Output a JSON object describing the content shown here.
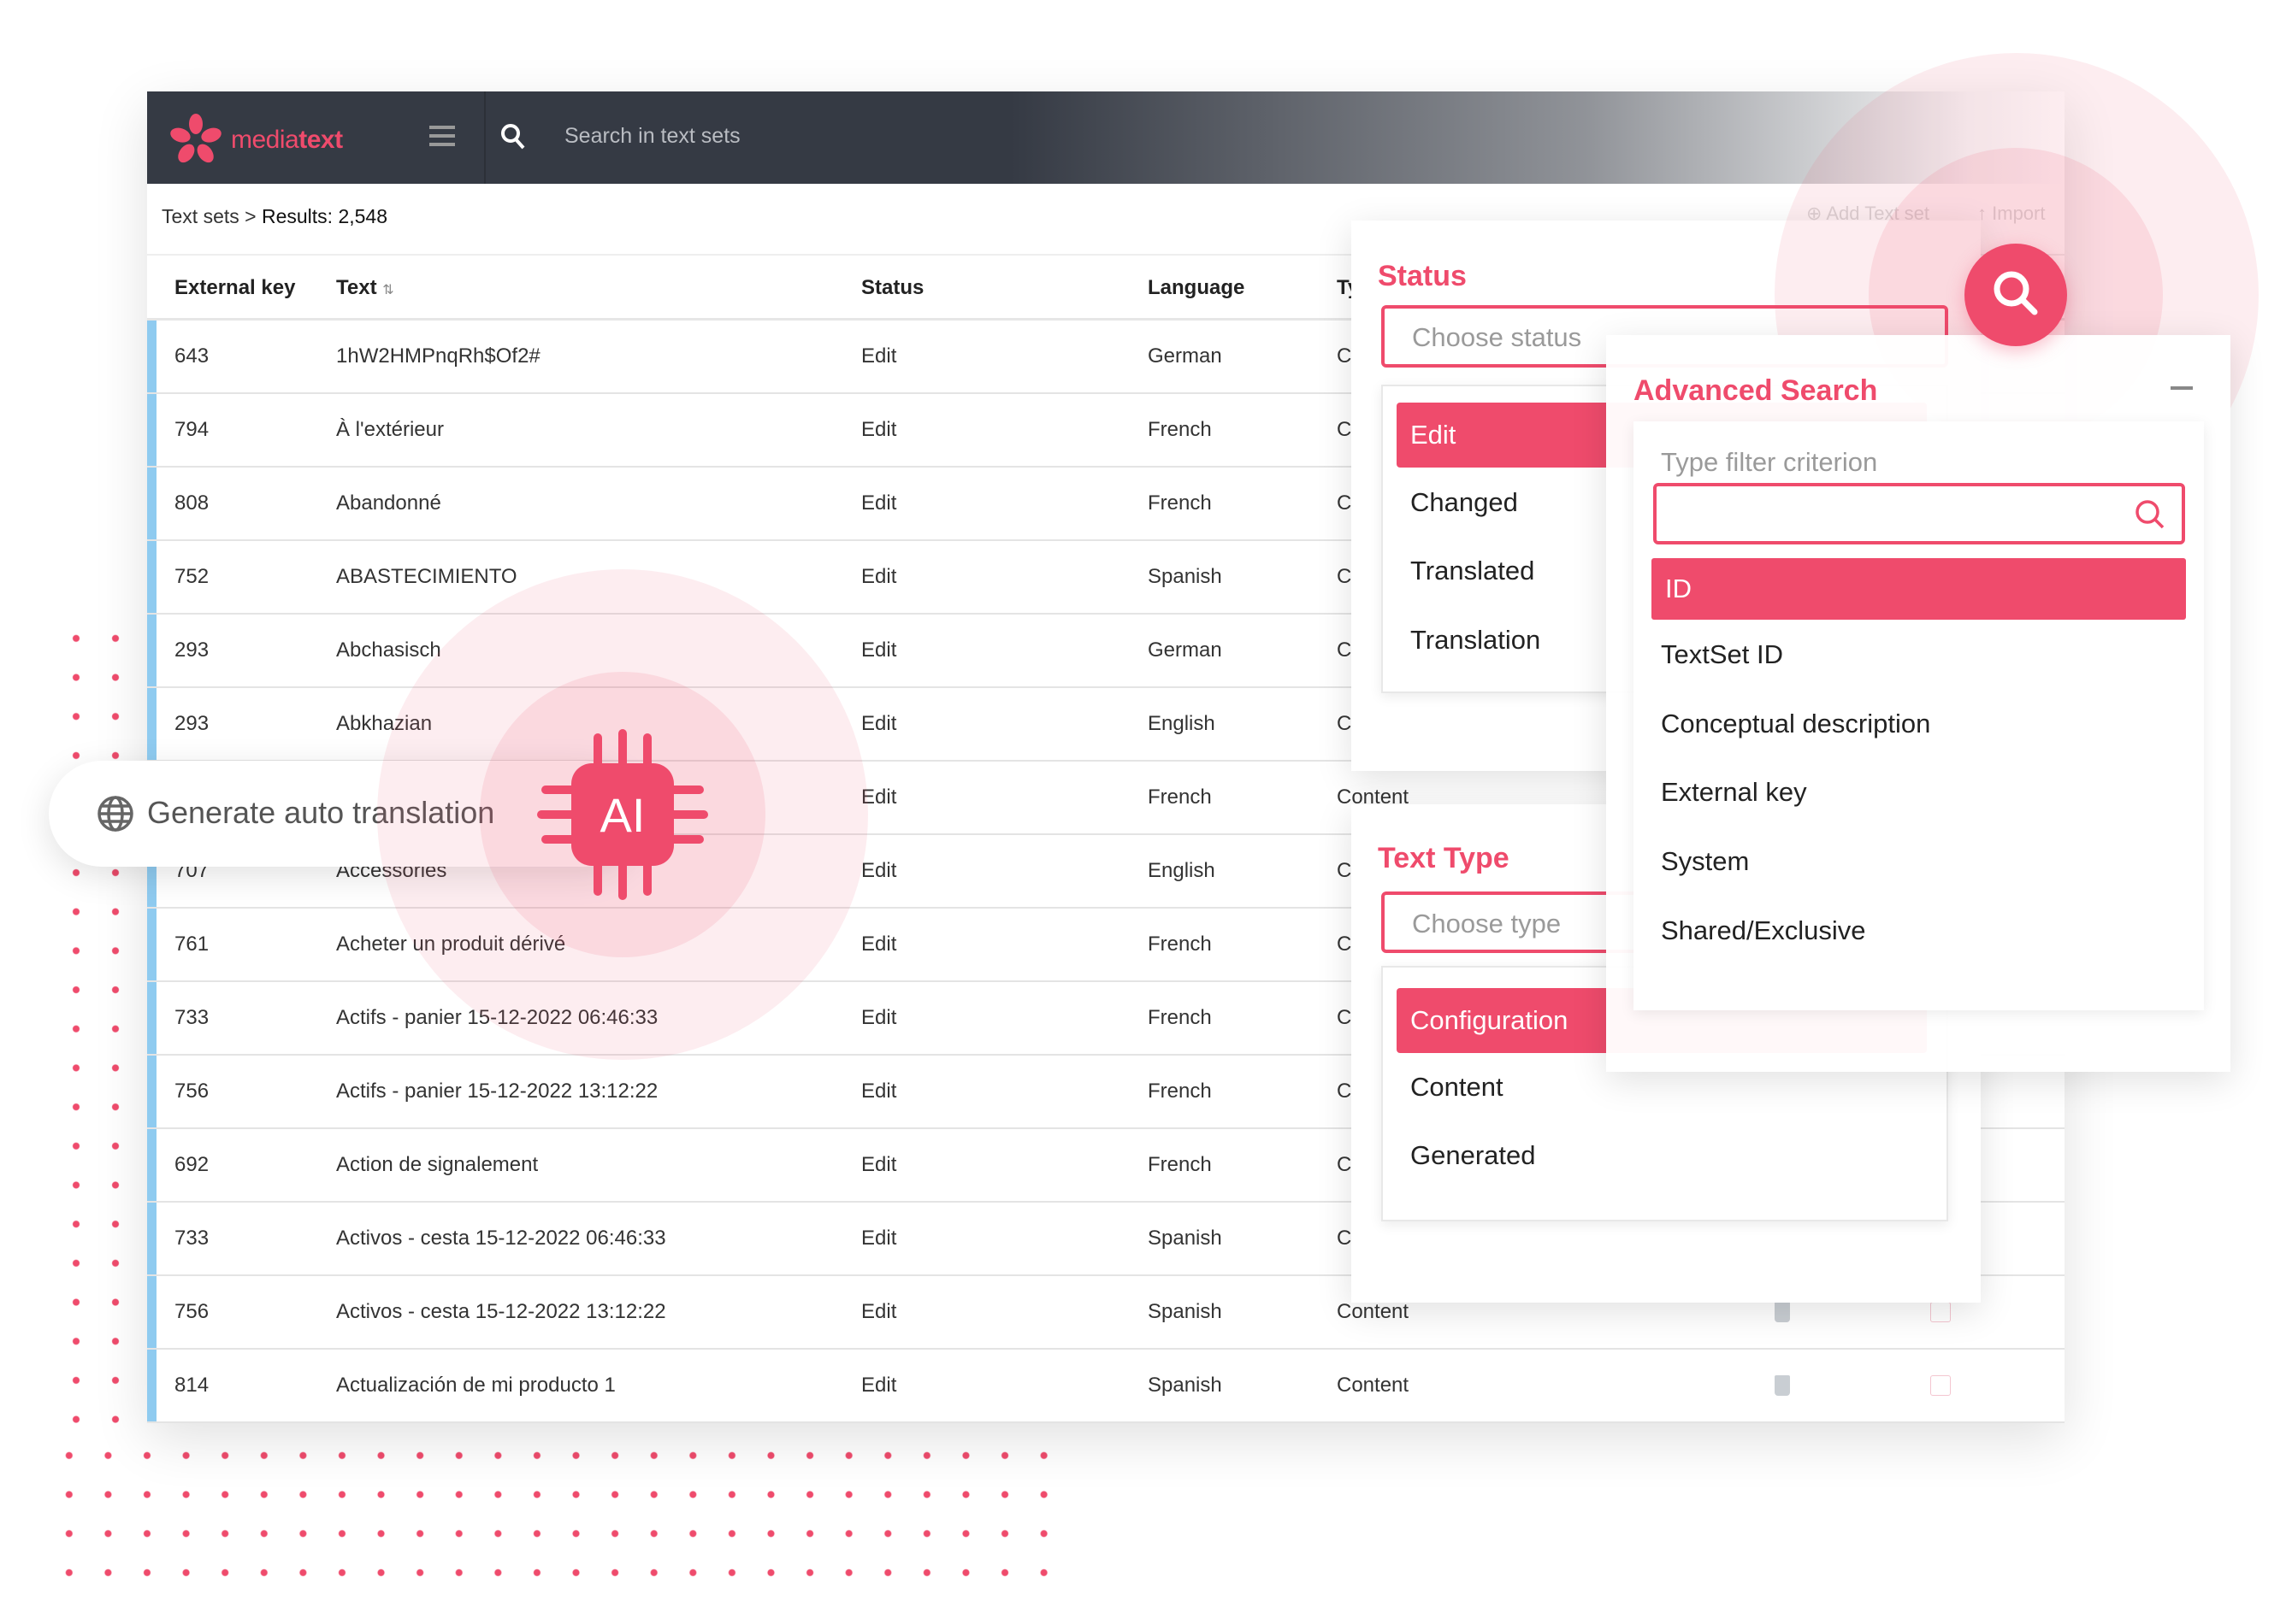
{
  "app": {
    "logo": {
      "part1": "media",
      "part2": "text"
    },
    "search_placeholder": "Search in text sets",
    "breadcrumb": {
      "root": "Text sets",
      "sep": ">",
      "results": "Results: 2,548"
    },
    "actions": {
      "add": "Add Text set",
      "import": "Import"
    }
  },
  "table": {
    "columns": {
      "external_key": "External key",
      "text": "Text",
      "status": "Status",
      "language": "Language",
      "type": "Type"
    },
    "rows": [
      {
        "key": "643",
        "text": "1hW2HMPnqRh$Of2#",
        "status": "Edit",
        "language": "German",
        "type": "Content"
      },
      {
        "key": "794",
        "text": "À l'extérieur",
        "status": "Edit",
        "language": "French",
        "type": "Content"
      },
      {
        "key": "808",
        "text": "Abandonné",
        "status": "Edit",
        "language": "French",
        "type": "Content"
      },
      {
        "key": "752",
        "text": "ABASTECIMIENTO",
        "status": "Edit",
        "language": "Spanish",
        "type": "Content"
      },
      {
        "key": "293",
        "text": "Abchasisch",
        "status": "Edit",
        "language": "German",
        "type": "Content"
      },
      {
        "key": "293",
        "text": "Abkhazian",
        "status": "Edit",
        "language": "English",
        "type": "Content"
      },
      {
        "key": "",
        "text": "",
        "status": "Edit",
        "language": "French",
        "type": "Content"
      },
      {
        "key": "707",
        "text": "Accessories",
        "status": "Edit",
        "language": "English",
        "type": "Content"
      },
      {
        "key": "761",
        "text": "Acheter un produit dérivé",
        "status": "Edit",
        "language": "French",
        "type": "Content"
      },
      {
        "key": "733",
        "text": "Actifs - panier 15-12-2022 06:46:33",
        "status": "Edit",
        "language": "French",
        "type": "Content"
      },
      {
        "key": "756",
        "text": "Actifs - panier 15-12-2022 13:12:22",
        "status": "Edit",
        "language": "French",
        "type": "Content"
      },
      {
        "key": "692",
        "text": "Action de signalement",
        "status": "Edit",
        "language": "French",
        "type": "Content"
      },
      {
        "key": "733",
        "text": "Activos - cesta 15-12-2022 06:46:33",
        "status": "Edit",
        "language": "Spanish",
        "type": "Content"
      },
      {
        "key": "756",
        "text": "Activos - cesta 15-12-2022 13:12:22",
        "status": "Edit",
        "language": "Spanish",
        "type": "Content"
      },
      {
        "key": "814",
        "text": "Actualización de mi producto 1",
        "status": "Edit",
        "language": "Spanish",
        "type": "Content"
      }
    ]
  },
  "status_filter": {
    "title": "Status",
    "placeholder": "Choose status",
    "options": [
      "Edit",
      "Changed",
      "Translated",
      "Translation"
    ],
    "selected": "Edit"
  },
  "type_filter": {
    "title": "Text Type",
    "placeholder": "Choose type",
    "options": [
      "Configuration",
      "Content",
      "Generated"
    ],
    "selected": "Configuration"
  },
  "advanced_search": {
    "title": "Advanced Search",
    "criterion_label": "Type filter criterion",
    "input_value": "",
    "options": [
      "ID",
      "TextSet ID",
      "Conceptual description",
      "External key",
      "System",
      "Shared/Exclusive"
    ],
    "selected": "ID"
  },
  "ai_promo": {
    "label": "Generate auto translation",
    "chip": "AI"
  },
  "colors": {
    "accent": "#ef4b6c",
    "header": "#353a44",
    "row_marker": "#8fcbf0"
  }
}
